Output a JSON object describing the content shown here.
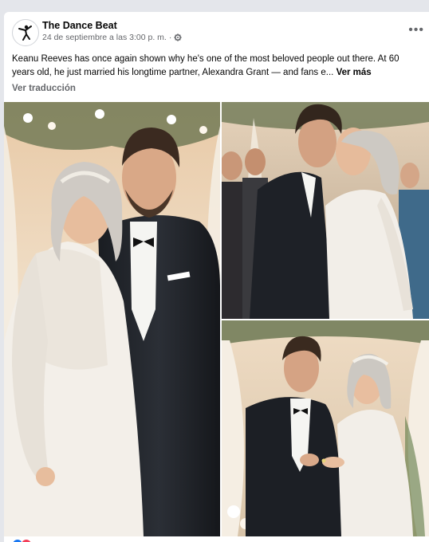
{
  "post": {
    "page_name": "The Dance Beat",
    "timestamp": "24 de septiembre a las 3:00 p. m.",
    "privacy_separator": "·",
    "privacy_icon": "gear-icon",
    "more_icon": "more-options-icon",
    "more_label": "•••",
    "text": "Keanu Reeves has once again shown why he's one of the most beloved people out there. At 60 years old, he just married his longtime partner, Alexandra Grant — and fans e...",
    "see_more": "Ver más",
    "translate": "Ver traducción"
  },
  "photos": [
    {
      "name": "wedding-portrait-photo"
    },
    {
      "name": "wedding-kiss-photo"
    },
    {
      "name": "ring-exchange-photo"
    }
  ],
  "colors": {
    "page_bg": "#e4e6eb",
    "card_bg": "#ffffff",
    "secondary_text": "#65676b",
    "like_blue": "#1877f2",
    "love_red": "#f33e58"
  }
}
